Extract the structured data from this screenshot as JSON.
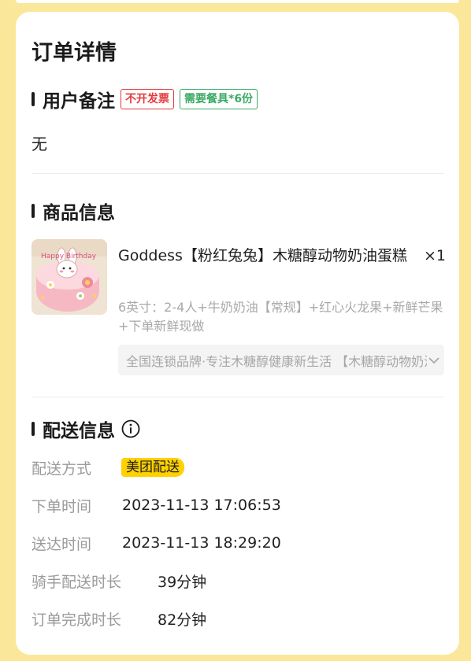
{
  "page": {
    "title": "订单详情"
  },
  "remarks_section": {
    "title": "用户备注",
    "tags": {
      "invoice": "不开发票",
      "tableware": "需要餐具*6份"
    },
    "content": "无"
  },
  "product_section": {
    "title": "商品信息",
    "product": {
      "name": "Goddess【粉红兔兔】木糖醇动物奶油蛋糕",
      "quantity": "×1",
      "spec": "6英寸：2-4人+牛奶奶油【常规】+红心火龙果+新鲜芒果+下单新鲜现做",
      "description": "全国连锁品牌·专注木糖醇健康新生活 【木糖醇动物奶油蛋糕】",
      "thumbnail_text": "Happy Birthday"
    }
  },
  "delivery_section": {
    "title": "配送信息",
    "rows": [
      {
        "label": "配送方式",
        "value": "美团配送"
      },
      {
        "label": "下单时间",
        "value": "2023-11-13 17:06:53"
      },
      {
        "label": "送达时间",
        "value": "2023-11-13 18:29:20"
      },
      {
        "label": "骑手配送时长",
        "value": "39分钟"
      },
      {
        "label": "订单完成时长",
        "value": "82分钟"
      }
    ]
  },
  "colors": {
    "background": "#fbe79a",
    "tag_red": "#e4393c",
    "tag_green": "#3bab63",
    "delivery_badge": "#ffd100"
  }
}
